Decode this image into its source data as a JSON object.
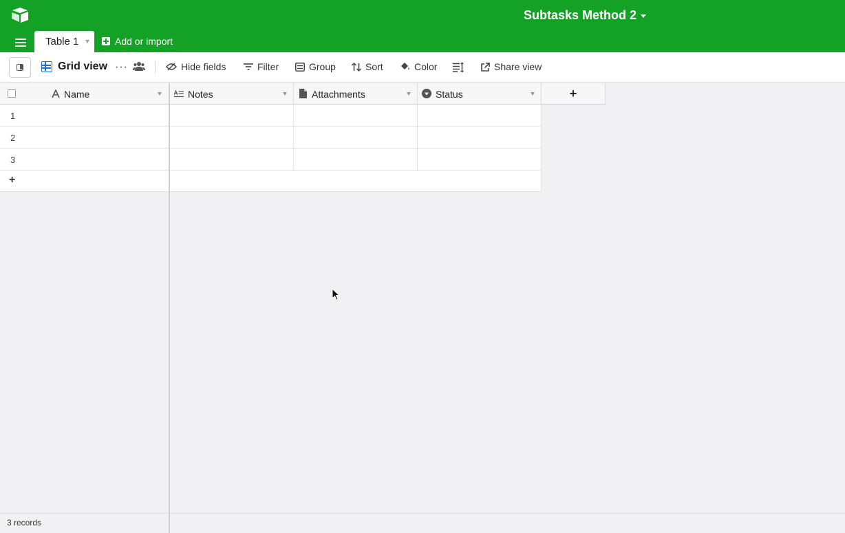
{
  "base": {
    "title": "Subtasks Method 2"
  },
  "tabs": {
    "active": "Table 1",
    "add_label": "Add or import"
  },
  "toolbar": {
    "view_name": "Grid view",
    "more_label": "···",
    "hide_fields": "Hide fields",
    "filter": "Filter",
    "group": "Group",
    "sort": "Sort",
    "color": "Color",
    "share_view": "Share view"
  },
  "columns": [
    {
      "name": "Name",
      "icon": "text-icon"
    },
    {
      "name": "Notes",
      "icon": "long-text-icon"
    },
    {
      "name": "Attachments",
      "icon": "attachment-icon"
    },
    {
      "name": "Status",
      "icon": "single-select-icon"
    }
  ],
  "add_column_label": "+",
  "rows": [
    "1",
    "2",
    "3"
  ],
  "add_row_label": "+",
  "footer": {
    "record_count": "3 records"
  },
  "colors": {
    "header_green": "#13a126",
    "accent_blue": "#1a6fd1"
  }
}
